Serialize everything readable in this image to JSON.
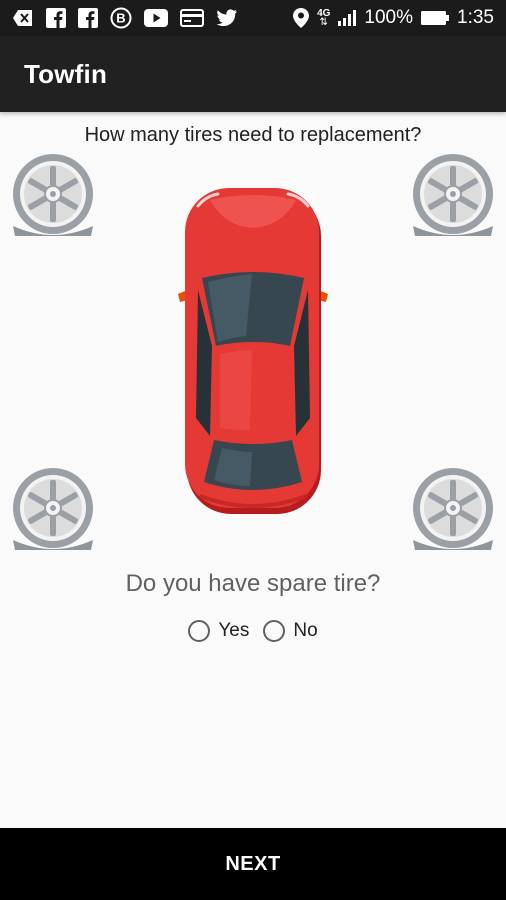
{
  "status_bar": {
    "icons": [
      "back-arrow-icon",
      "facebook-icon",
      "facebook-icon",
      "b-circle-icon",
      "youtube-icon",
      "card-icon",
      "twitter-icon",
      "location-pin-icon",
      "network-4g-icon",
      "signal-icon",
      "battery-icon"
    ],
    "network": "4G",
    "battery": "100%",
    "time": "1:35"
  },
  "app_bar": {
    "title": "Towfin"
  },
  "tires": {
    "question": "How many tires need to replacement?",
    "items": [
      "front-left",
      "front-right",
      "rear-left",
      "rear-right"
    ]
  },
  "car": {
    "color": "#e53935"
  },
  "spare": {
    "question": "Do you have spare tire?",
    "options": [
      {
        "label": "Yes",
        "selected": false
      },
      {
        "label": "No",
        "selected": false
      }
    ]
  },
  "footer": {
    "next_label": "NEXT"
  },
  "colors": {
    "status_bar": "#1b1b1b",
    "app_bar": "#212121",
    "background": "#fafafa",
    "footer": "#000000",
    "tire": "#9e9e9e"
  }
}
